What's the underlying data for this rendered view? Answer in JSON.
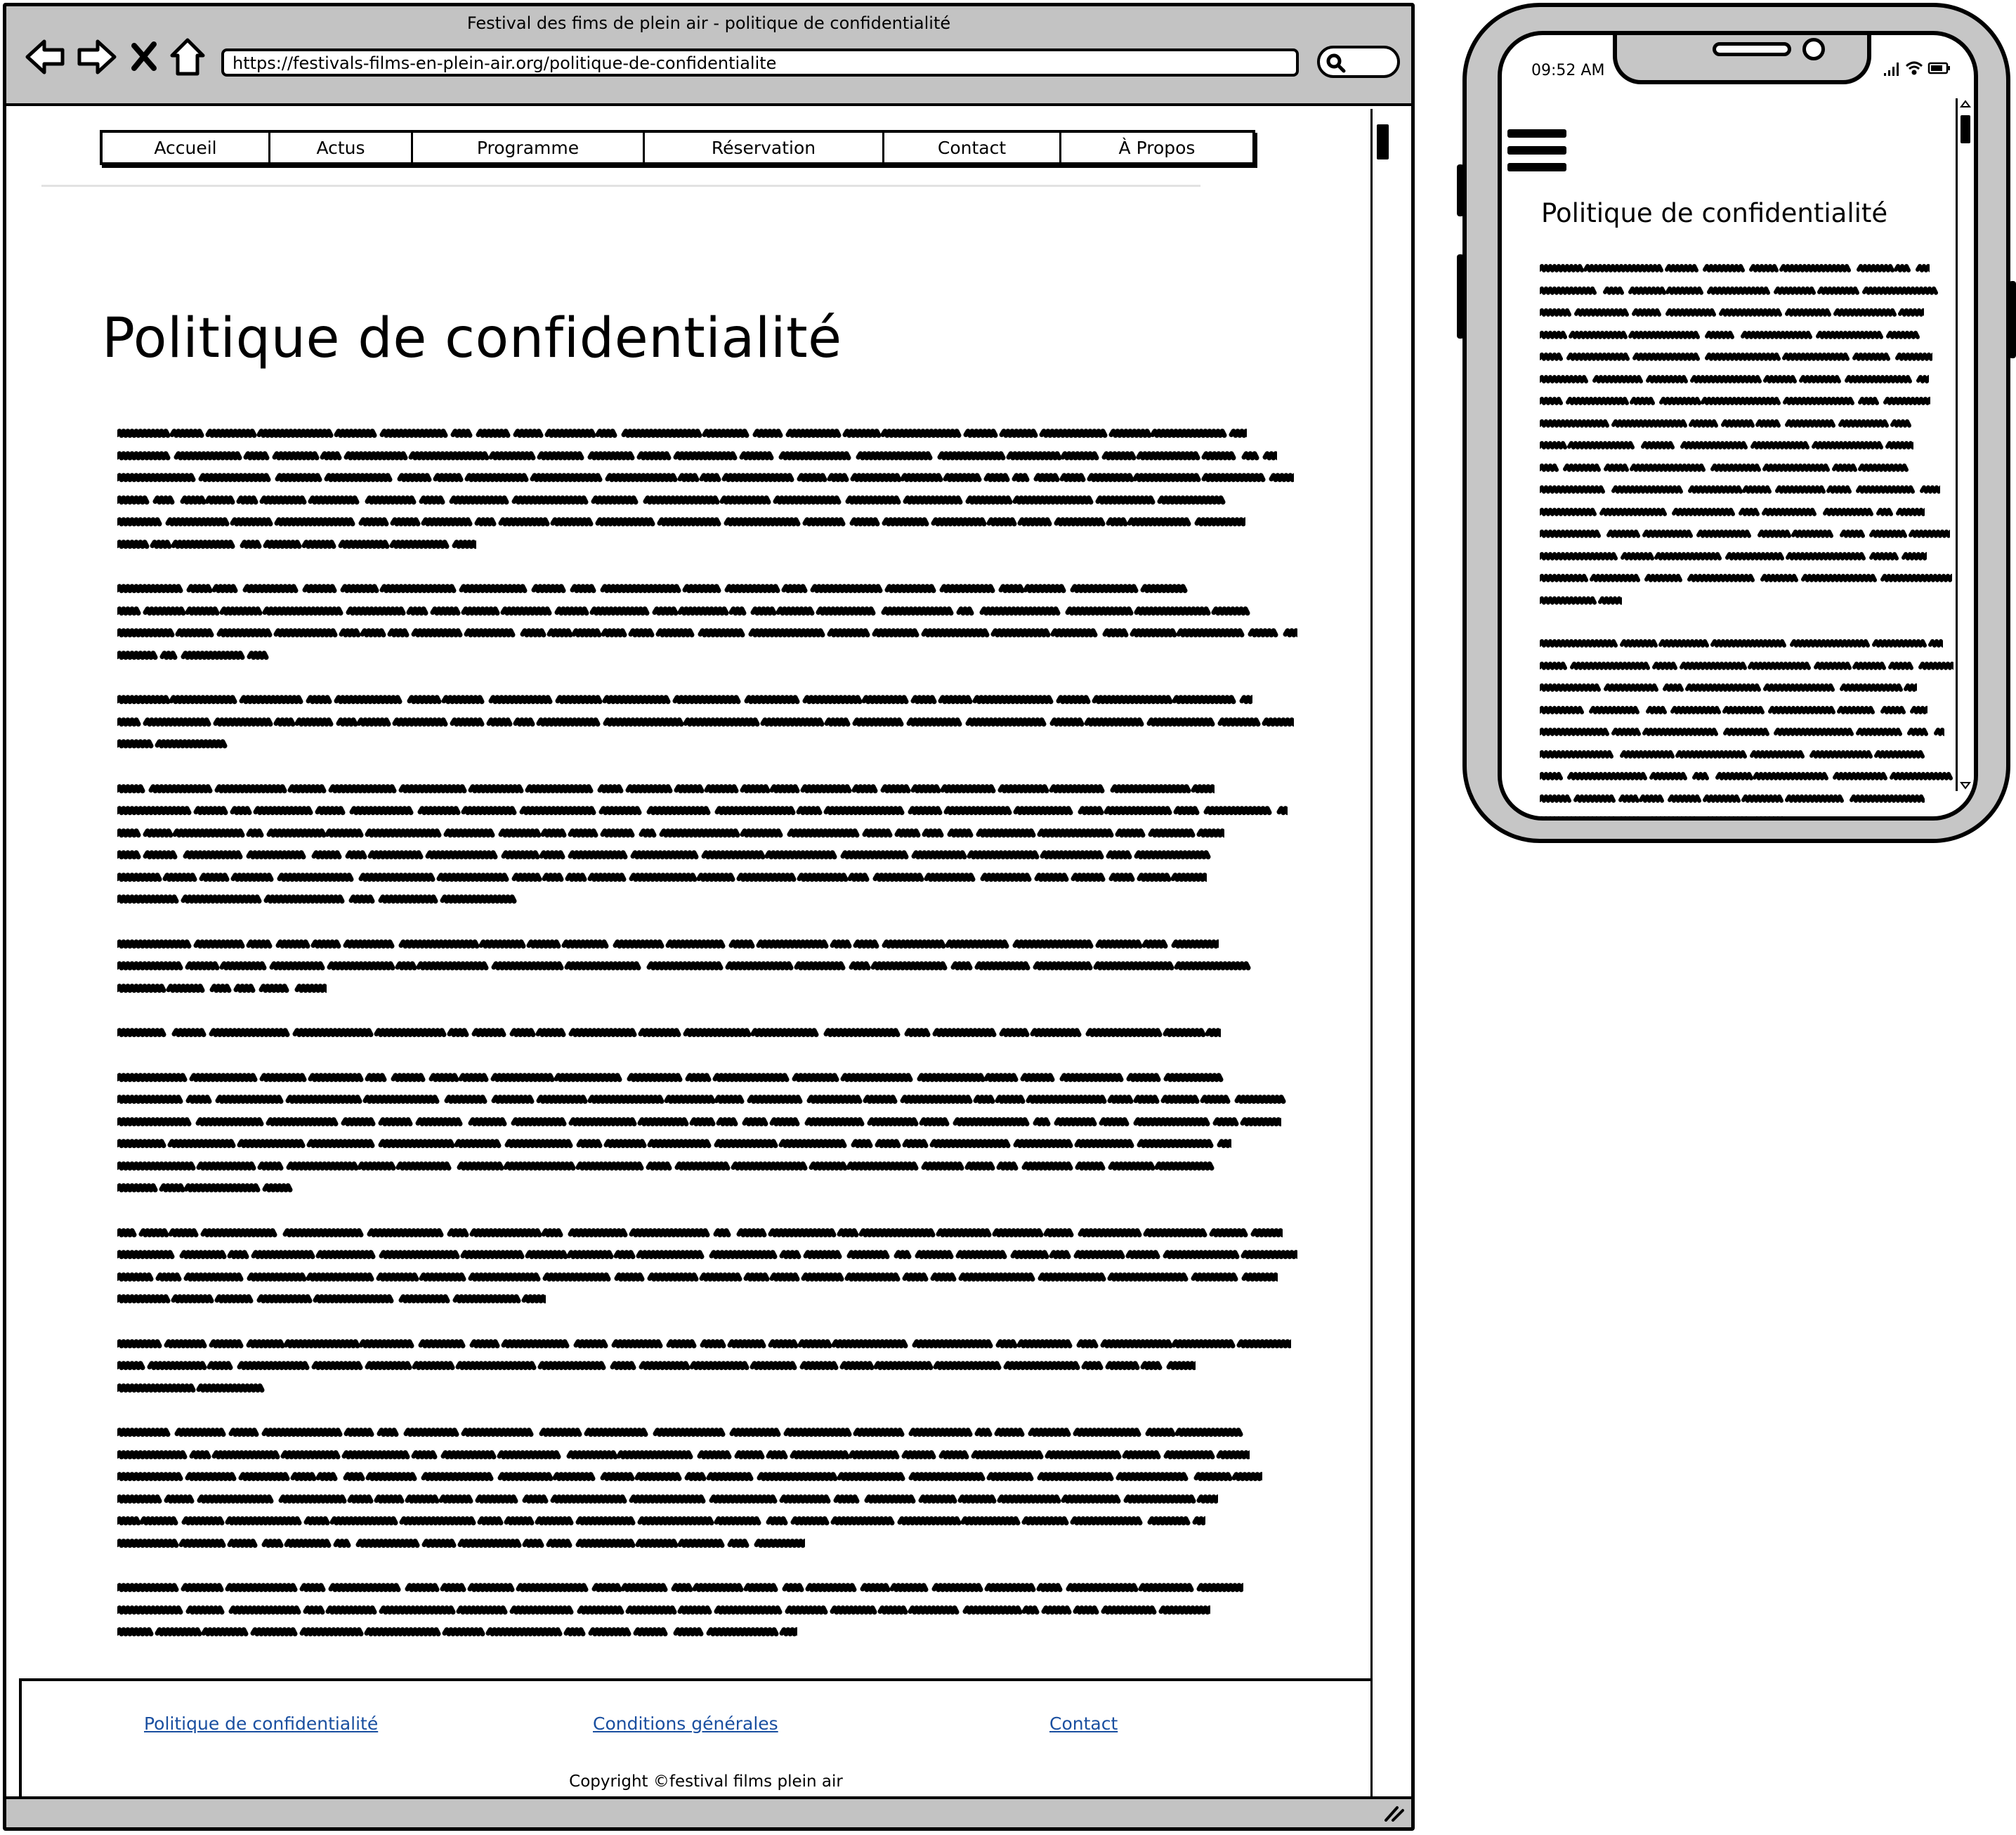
{
  "browser": {
    "window_title": "Festival des fims de plein air - politique de confidentialité",
    "url": "https://festivals-films-en-plein-air.org/politique-de-confidentialite",
    "icons": [
      "back-arrow-icon",
      "forward-arrow-icon",
      "stop-x-icon",
      "home-icon",
      "search-icon",
      "resize-grip-icon"
    ]
  },
  "nav": {
    "items": [
      {
        "label": "Accueil"
      },
      {
        "label": "Actus"
      },
      {
        "label": "Programme"
      },
      {
        "label": "Réservation"
      },
      {
        "label": "Contact"
      },
      {
        "label": "À Propos"
      }
    ]
  },
  "page": {
    "title": "Politique de confidentialité",
    "paragraph_line_counts": [
      6,
      4,
      3,
      6,
      3,
      1,
      6,
      4,
      3,
      6,
      3
    ]
  },
  "footer": {
    "links": [
      {
        "label": "Politique de confidentialité"
      },
      {
        "label": "Conditions générales"
      },
      {
        "label": "Contact"
      }
    ],
    "copyright": "Copyright ©festival films plein air"
  },
  "mobile": {
    "time": "09:52 AM",
    "title": "Politique de confidentialité",
    "menu_icon": "hamburger-menu-icon",
    "status_icons": [
      "signal-icon",
      "wifi-icon",
      "battery-icon"
    ],
    "paragraph_line_counts": [
      16,
      9
    ]
  },
  "colors": {
    "chrome": "#c3c3c3",
    "link": "#1a4fa0",
    "phone_frame": "#c6c6c6"
  }
}
